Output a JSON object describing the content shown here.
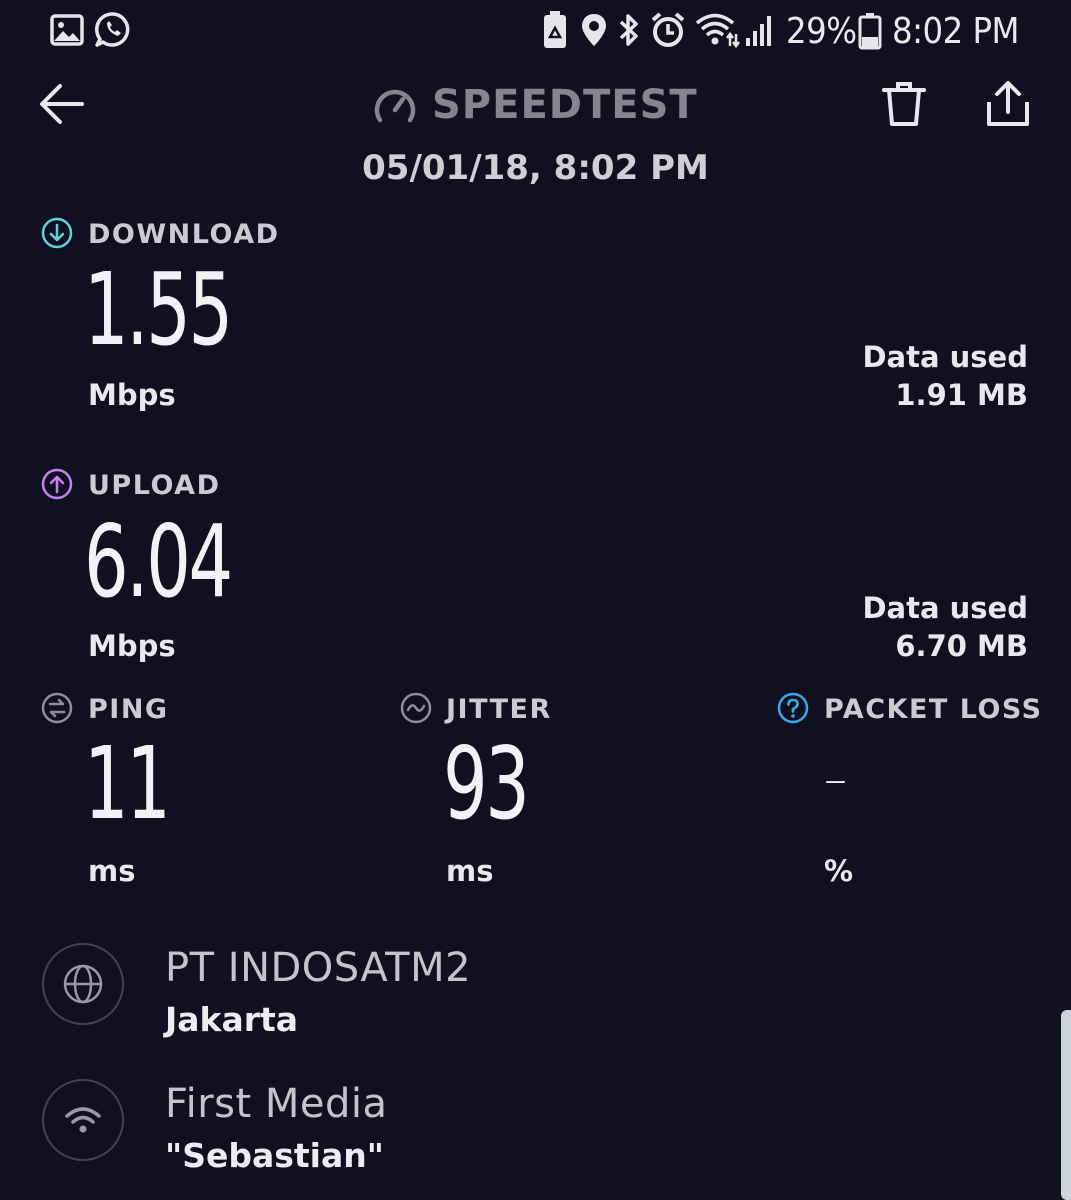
{
  "status_bar": {
    "battery": "29%",
    "time": "8:02 PM",
    "icons": [
      "gallery-icon",
      "whatsapp-icon",
      "recycle-battery-icon",
      "location-icon",
      "bluetooth-icon",
      "alarm-icon",
      "wifi-icon",
      "signal-icon",
      "battery-icon"
    ]
  },
  "header": {
    "title": "SPEEDTEST",
    "date": "05/01/18, 8:02 PM"
  },
  "download": {
    "label": "DOWNLOAD",
    "value": "1.55",
    "unit": "Mbps",
    "data_used_label": "Data used",
    "data_used_value": "1.91 MB",
    "icon_color": "#5fd3d6"
  },
  "upload": {
    "label": "UPLOAD",
    "value": "6.04",
    "unit": "Mbps",
    "data_used_label": "Data used",
    "data_used_value": "6.70 MB",
    "icon_color": "#c382f2"
  },
  "ping": {
    "label": "PING",
    "value": "11",
    "unit": "ms"
  },
  "jitter": {
    "label": "JITTER",
    "value": "93",
    "unit": "ms"
  },
  "packet_loss": {
    "label": "PACKET LOSS",
    "value": "–",
    "unit": "%",
    "icon_color": "#3aa8e8"
  },
  "server": {
    "name": "PT INDOSATM2",
    "location": "Jakarta"
  },
  "connection": {
    "provider": "First Media",
    "ssid": "\"Sebastian\""
  }
}
